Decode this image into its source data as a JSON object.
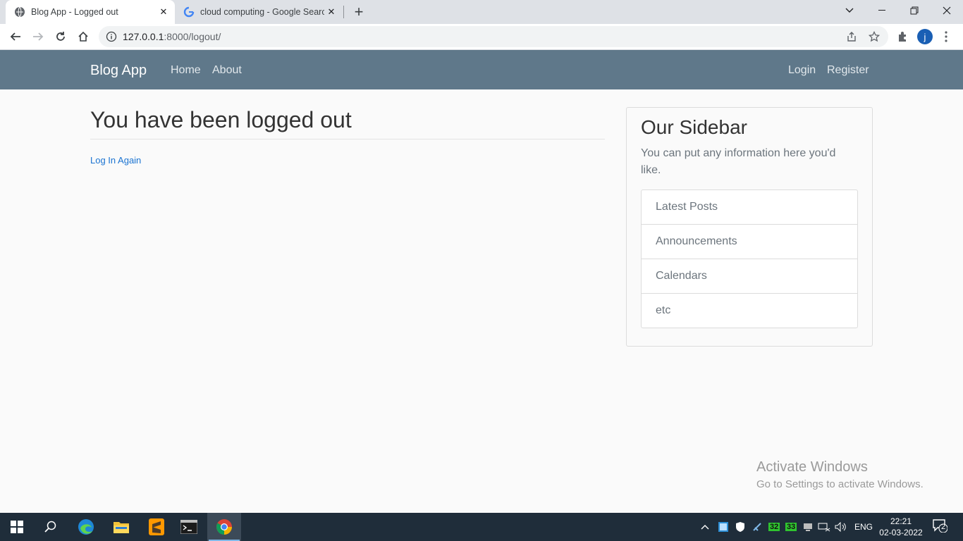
{
  "browser": {
    "tabs": [
      {
        "title": "Blog App - Logged out",
        "favicon": "globe-icon",
        "active": true
      },
      {
        "title": "cloud computing - Google Search",
        "favicon": "google-icon",
        "active": false
      }
    ],
    "address": {
      "host": "127.0.0.1",
      "rest": ":8000/logout/"
    },
    "avatar_letter": "j"
  },
  "navbar": {
    "brand": "Blog App",
    "left_links": [
      "Home",
      "About"
    ],
    "right_links": [
      "Login",
      "Register"
    ],
    "color": "#5f788a"
  },
  "main": {
    "heading": "You have been logged out",
    "link": "Log In Again"
  },
  "sidebar": {
    "title": "Our Sidebar",
    "description": "You can put any information here you'd like.",
    "items": [
      "Latest Posts",
      "Announcements",
      "Calendars",
      "etc"
    ]
  },
  "watermark": {
    "line1": "Activate Windows",
    "line2": "Go to Settings to activate Windows."
  },
  "taskbar": {
    "tray": {
      "lang": "ENG",
      "badge1": "32",
      "badge2": "33",
      "notifications": "2"
    },
    "time": "22:21",
    "date": "02-03-2022"
  }
}
